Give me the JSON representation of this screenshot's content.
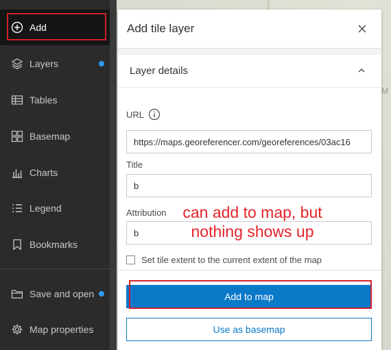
{
  "sidebar": {
    "items": [
      {
        "label": "Add",
        "icon": "plus-circle-icon"
      },
      {
        "label": "Layers",
        "icon": "layers-icon",
        "indicator": true
      },
      {
        "label": "Tables",
        "icon": "table-icon"
      },
      {
        "label": "Basemap",
        "icon": "basemap-icon"
      },
      {
        "label": "Charts",
        "icon": "chart-icon"
      },
      {
        "label": "Legend",
        "icon": "legend-icon"
      },
      {
        "label": "Bookmarks",
        "icon": "bookmark-icon"
      },
      {
        "label": "Save and open",
        "icon": "folder-icon",
        "indicator": true
      },
      {
        "label": "Map properties",
        "icon": "gear-icon"
      }
    ]
  },
  "panel": {
    "title": "Add tile layer",
    "section_title": "Layer details",
    "url_label": "URL",
    "url_value": "https://maps.georeferencer.com/georeferences/03ac16",
    "title_label": "Title",
    "title_value": "b",
    "attribution_label": "Attribution",
    "attribution_value": "b",
    "checkbox_label": "Set tile extent to the current extent of the map",
    "primary_button": "Add to map",
    "secondary_button": "Use as basemap"
  },
  "annotation": {
    "line1": "can add to map, but",
    "line2": "nothing shows up"
  },
  "map": {
    "label": "M"
  },
  "colors": {
    "accent": "#0a79c8",
    "highlight": "#d0212b",
    "indicator": "#2e9bf0",
    "sidebar_bg": "#2b2b2b"
  }
}
